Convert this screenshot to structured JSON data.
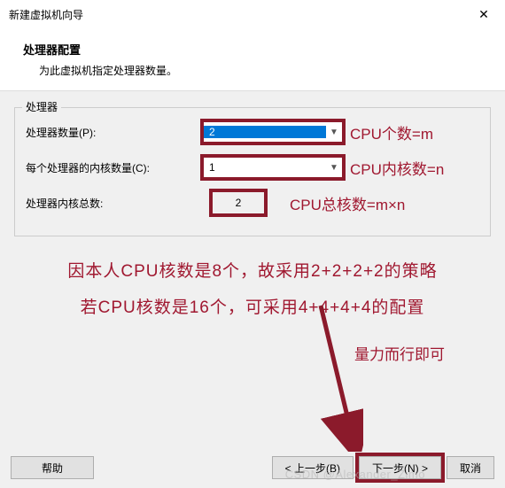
{
  "window": {
    "title": "新建虚拟机向导",
    "close": "✕"
  },
  "header": {
    "title": "处理器配置",
    "subtitle": "为此虚拟机指定处理器数量。"
  },
  "group": {
    "legend": "处理器",
    "rows": {
      "processors": {
        "label": "处理器数量(P):",
        "value": "2",
        "annot": "CPU个数=m"
      },
      "cores": {
        "label": "每个处理器的内核数量(C):",
        "value": "1",
        "annot": "CPU内核数=n"
      },
      "total": {
        "label": "处理器内核总数:",
        "value": "2",
        "annot": "CPU总核数=m×n"
      }
    }
  },
  "notes": {
    "line1": "因本人CPU核数是8个，故采用2+2+2+2的策略",
    "line2": "若CPU核数是16个，可采用4+4+4+4的配置",
    "small": "量力而行即可"
  },
  "footer": {
    "help": "帮助",
    "back": "< 上一步(B)",
    "next": "下一步(N) >",
    "cancel": "取消"
  },
  "watermark": "CSDN @Alexander_Zimo"
}
